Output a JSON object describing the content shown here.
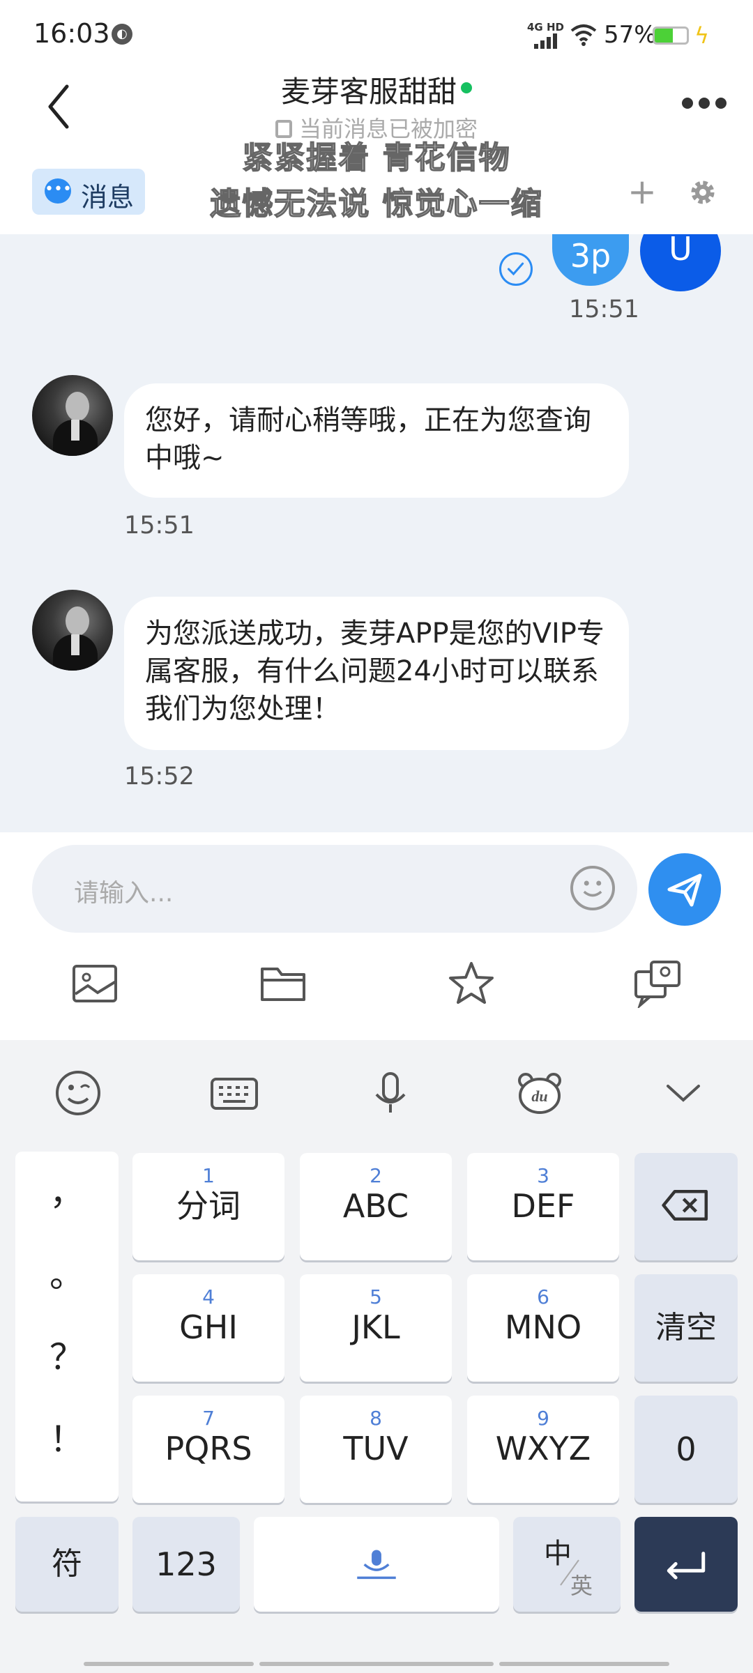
{
  "status_bar": {
    "time": "16:03",
    "network": "4G HD",
    "battery": "57%",
    "battery_level": 0.57
  },
  "header": {
    "back_icon": "chevron-left-icon",
    "title": "麦芽客服甜甜",
    "encryption_note": "当前消息已被加密",
    "more_icon": "more-horizontal-icon",
    "tab_label": "消息",
    "add_icon": "plus-icon",
    "settings_icon": "gear-icon"
  },
  "lyrics": {
    "line1": "紧紧握着 青花信物",
    "line2": "遗憾无法说 惊觉心一缩"
  },
  "chat": {
    "my_bubble_text": "3p",
    "my_avatar_text": "U",
    "my_time": "15:51",
    "messages": [
      {
        "text": "您好，请耐心稍等哦，正在为您查询中哦~",
        "time": "15:51"
      },
      {
        "text": "为您派送成功，麦芽APP是您的VIP专属客服，有什么问题24小时可以联系我们为您处理！",
        "time": "15:52"
      }
    ]
  },
  "input_bar": {
    "placeholder": "请输入...",
    "tools": [
      "image-icon",
      "folder-icon",
      "star-icon",
      "screenshot-icon"
    ]
  },
  "keyboard": {
    "toolbar": [
      "emoji-icon",
      "keyboard-icon",
      "microphone-icon",
      "du-bear-icon",
      "collapse-icon"
    ],
    "punct": [
      "，",
      "。",
      "？",
      "！"
    ],
    "keys": [
      {
        "num": "1",
        "label": "分词"
      },
      {
        "num": "2",
        "label": "ABC"
      },
      {
        "num": "3",
        "label": "DEF"
      },
      {
        "num": "4",
        "label": "GHI"
      },
      {
        "num": "5",
        "label": "JKL"
      },
      {
        "num": "6",
        "label": "MNO"
      },
      {
        "num": "7",
        "label": "PQRS"
      },
      {
        "num": "8",
        "label": "TUV"
      },
      {
        "num": "9",
        "label": "WXYZ"
      }
    ],
    "clear": "清空",
    "zero": "0",
    "symbol": "符",
    "numeric": "123",
    "lang_cn": "中",
    "lang_en": "英"
  }
}
